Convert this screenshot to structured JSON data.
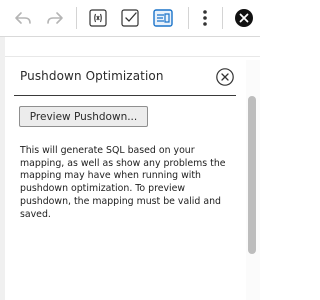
{
  "toolbar": {
    "icons": [
      "undo-icon",
      "redo-icon",
      "formula-icon",
      "validate-icon",
      "pushdown-optimization-icon",
      "more-options-icon",
      "close-circle-icon"
    ]
  },
  "panel": {
    "title": "Pushdown Optimization",
    "preview_button_label": "Preview Pushdown...",
    "description": "This will generate SQL based on your mapping, as well as show any problems the mapping may have when running with pushdown optimization. To preview pushdown, the mapping must be valid and saved."
  },
  "colors": {
    "active_icon_blue": "#1a73c9",
    "icon_gray": "#b5b5b5",
    "icon_dark": "#333333"
  }
}
